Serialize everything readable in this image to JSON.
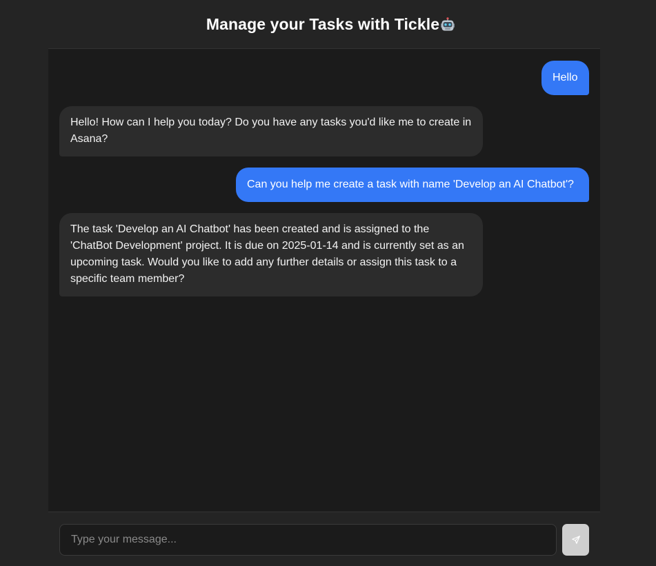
{
  "header": {
    "title": "Manage your Tasks with Tickle",
    "icon": "robot-icon"
  },
  "messages": [
    {
      "role": "user",
      "text": "Hello"
    },
    {
      "role": "bot",
      "text": "Hello! How can I help you today? Do you have any tasks you'd like me to create in Asana?"
    },
    {
      "role": "user",
      "text": "Can you help me create a task with name 'Develop an AI Chatbot'?"
    },
    {
      "role": "bot",
      "text": "The task 'Develop an AI Chatbot' has been created and is assigned to the 'ChatBot Development' project. It is due on 2025-01-14 and is currently set as an upcoming task. Would you like to add any further details or assign this task to a specific team member?"
    }
  ],
  "composer": {
    "placeholder": "Type your message...",
    "value": "",
    "send_icon": "send-icon"
  },
  "colors": {
    "background": "#242424",
    "chat_background": "#1b1b1b",
    "user_bubble": "#3478f6",
    "bot_bubble": "#2c2c2c",
    "send_button": "#cfcfcf"
  }
}
